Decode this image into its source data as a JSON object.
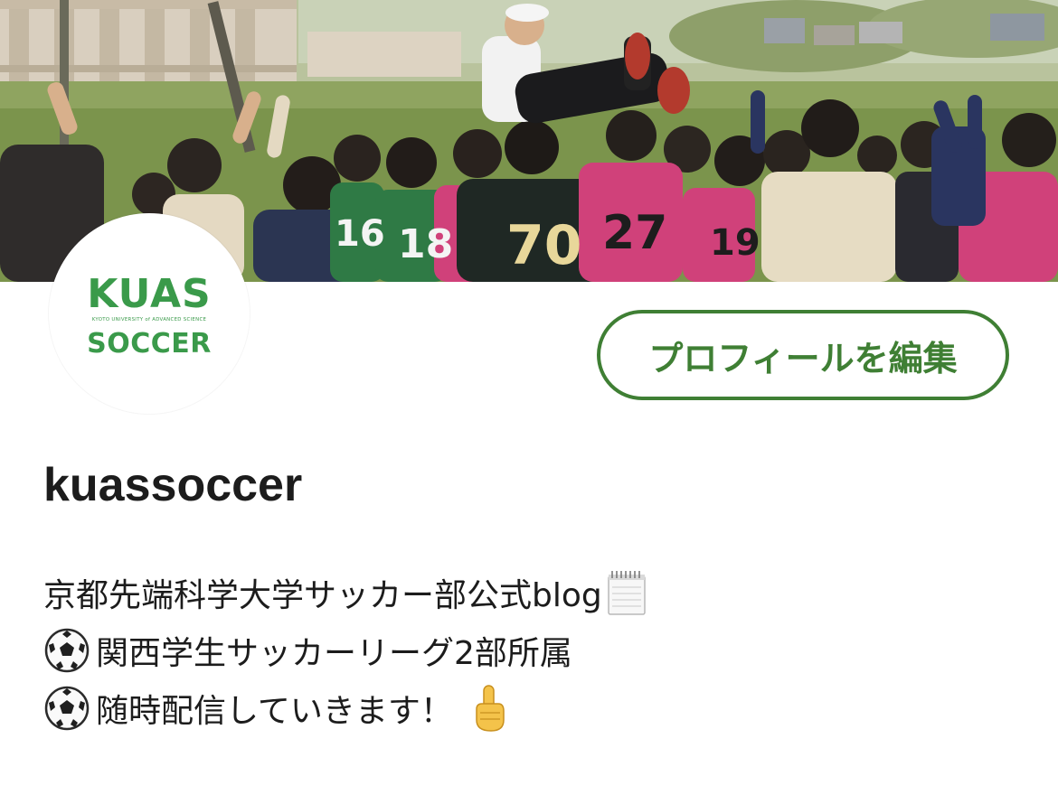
{
  "profile": {
    "username": "kuassoccer",
    "edit_button_label": "プロフィールを編集"
  },
  "avatar": {
    "logo_top": "KUAS",
    "logo_sub": "KYOTO UNIVERSITY of ADVANCED SCIENCE",
    "logo_bottom": "SOCCER",
    "color": "#3a9a4a"
  },
  "bio": {
    "line1": "京都先端科学大学サッカー部公式blog",
    "line2": "関西学生サッカーリーグ2部所属",
    "line3": "随時配信していきます！",
    "icons": [
      "notepad-icon",
      "soccer-ball-icon",
      "soccer-ball-icon",
      "pointing-up-icon"
    ]
  },
  "cover": {
    "jersey_numbers": [
      "16",
      "18",
      "70",
      "27",
      "19"
    ]
  },
  "colors": {
    "accent": "#3f7f34",
    "text": "#1c1c1c"
  }
}
